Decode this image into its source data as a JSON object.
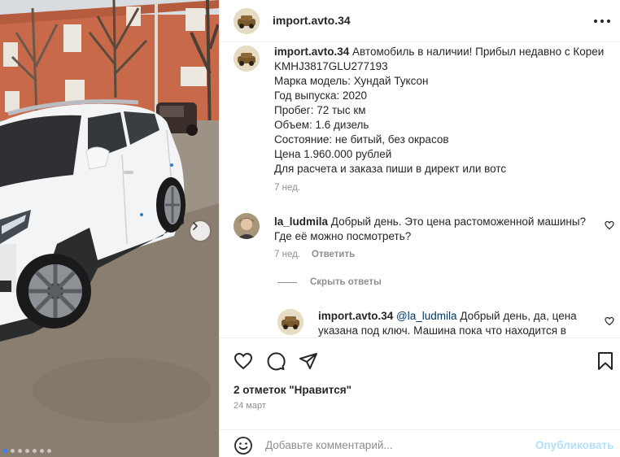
{
  "post": {
    "username": "import.avto.34",
    "caption_lines": [
      "Автомобиль в наличии! Прибыл недавно с Кореи",
      "KMHJ3817GLU277193",
      "Марка модель: Хундай Туксон",
      "Год выпуска: 2020",
      "Пробег: 72 тыс км",
      "Объем: 1.6 дизель",
      "Состояние: не битый, без окрасов",
      "Цена 1.960.000 рублей",
      "Для расчета и заказа пиши в директ или вотс"
    ],
    "caption_time": "7 нед."
  },
  "comments": [
    {
      "username": "la_ludmila",
      "text": "Добрый день. Это цена растоможенной машины? Где её можно посмотреть?",
      "time": "7 нед.",
      "reply_label": "Ответить"
    }
  ],
  "hide_replies_label": "Скрыть ответы",
  "reply": {
    "username": "import.avto.34",
    "mention": "@la_ludmila",
    "text": "Добрый день, да, цена указана под ключ. Машина пока что находится в"
  },
  "likes_text": "2 отметок \"Нравится\"",
  "date_text": "24 март",
  "add_comment": {
    "placeholder": "Добавьте комментарий...",
    "publish_label": "Опубликовать"
  },
  "carousel": {
    "slides": 7,
    "active_index": 0
  },
  "icons": {
    "more": "more-horizontal-icon",
    "like": "heart-icon",
    "comment": "comment-icon",
    "share": "send-icon",
    "save": "bookmark-icon",
    "emoji": "emoji-icon",
    "next": "chevron-right-icon"
  },
  "colors": {
    "link": "#00376b",
    "publish_disabled": "#b2dffc",
    "muted": "#8e8e8e",
    "dot_active": "#3b82f6"
  }
}
